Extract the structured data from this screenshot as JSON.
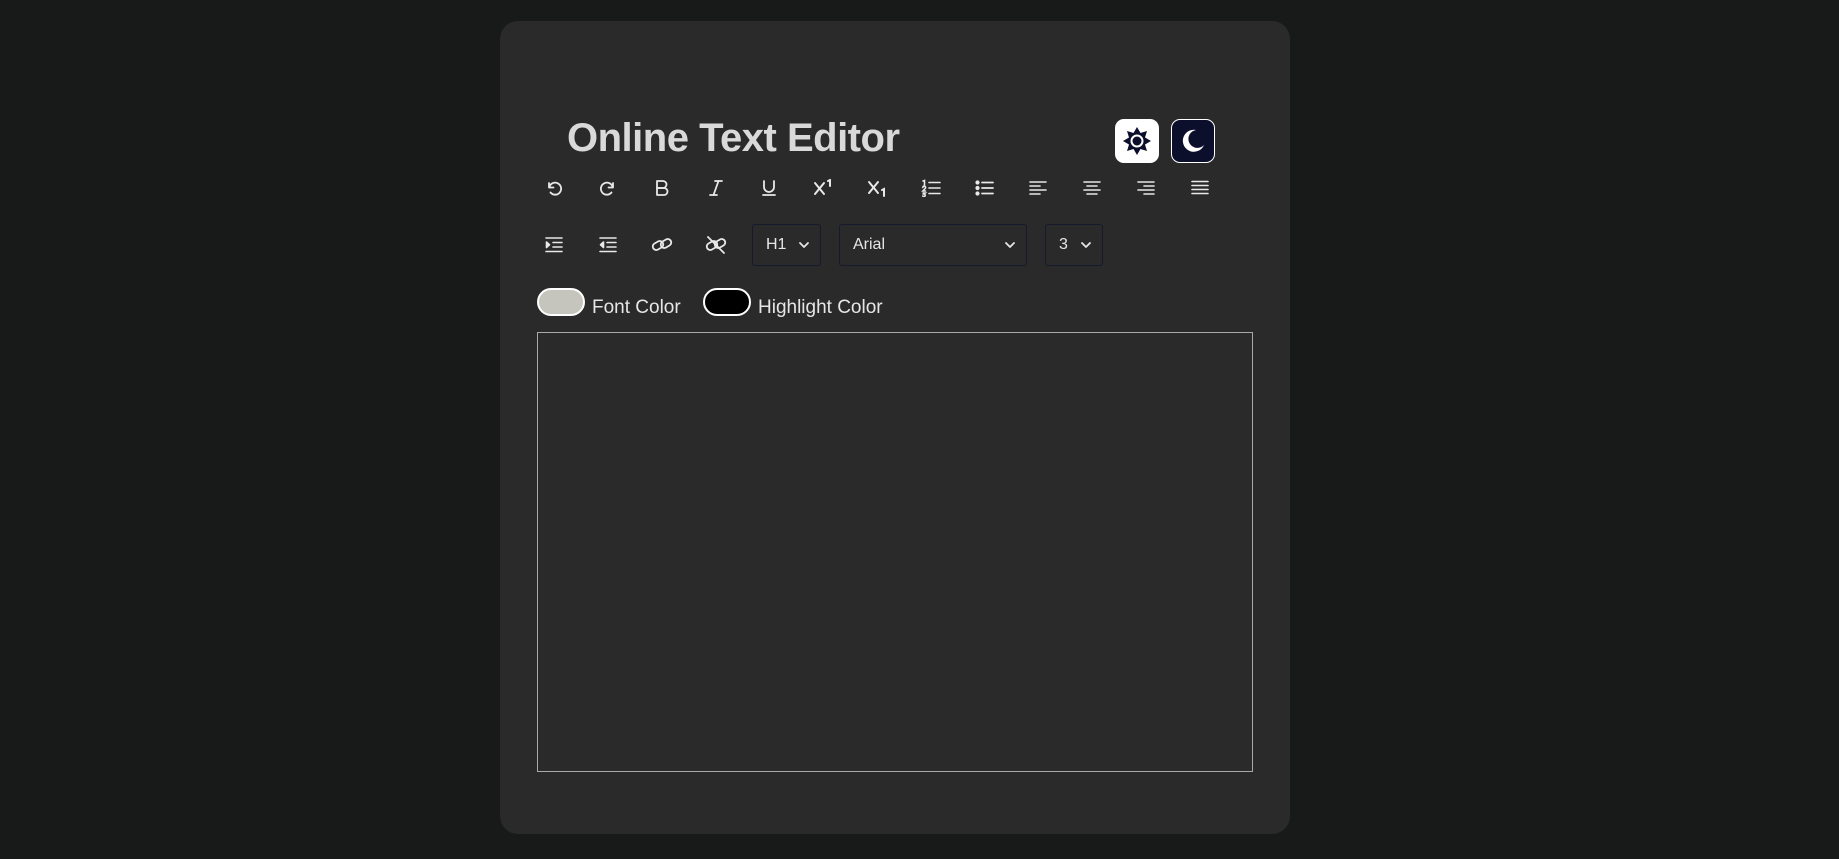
{
  "app": {
    "title": "Online Text Editor"
  },
  "theme": {
    "light_icon": "sun-icon",
    "dark_icon": "moon-icon",
    "light_bg": "#ffffff",
    "dark_bg": "#0b0f2b"
  },
  "toolbar": {
    "row1": [
      {
        "name": "undo",
        "icon": "undo-icon"
      },
      {
        "name": "redo",
        "icon": "redo-icon"
      },
      {
        "name": "bold",
        "icon": "bold-icon"
      },
      {
        "name": "italic",
        "icon": "italic-icon"
      },
      {
        "name": "underline",
        "icon": "underline-icon"
      },
      {
        "name": "superscript",
        "icon": "superscript-icon"
      },
      {
        "name": "subscript",
        "icon": "subscript-icon"
      },
      {
        "name": "ordered-list",
        "icon": "ordered-list-icon"
      },
      {
        "name": "unordered-list",
        "icon": "unordered-list-icon"
      },
      {
        "name": "align-left",
        "icon": "align-left-icon"
      },
      {
        "name": "align-center",
        "icon": "align-center-icon"
      },
      {
        "name": "align-right",
        "icon": "align-right-icon"
      },
      {
        "name": "align-justify",
        "icon": "align-justify-icon"
      }
    ],
    "row2": [
      {
        "name": "indent",
        "icon": "indent-icon"
      },
      {
        "name": "outdent",
        "icon": "outdent-icon"
      },
      {
        "name": "create-link",
        "icon": "link-icon"
      },
      {
        "name": "unlink",
        "icon": "unlink-icon"
      }
    ],
    "heading_select": {
      "value": "H1"
    },
    "font_select": {
      "value": "Arial"
    },
    "size_select": {
      "value": "3"
    }
  },
  "colors": {
    "font_color_label": "Font Color",
    "font_color_value": "#c5c5bd",
    "highlight_color_label": "Highlight Color",
    "highlight_color_value": "#000000"
  },
  "editor": {
    "content": ""
  }
}
